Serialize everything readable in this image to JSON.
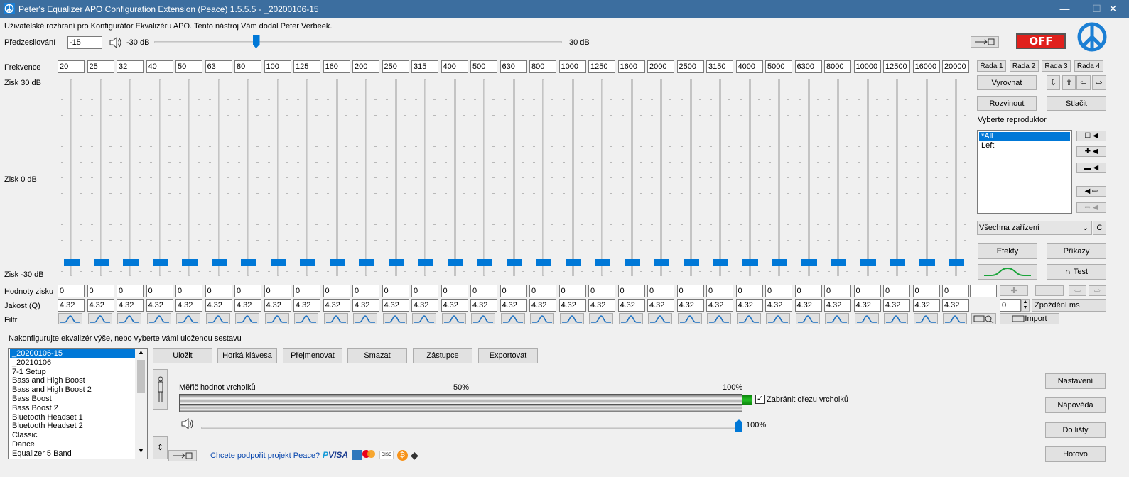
{
  "window": {
    "title": "Peter's Equalizer APO Configuration Extension (Peace) 1.5.5.5 - _20200106-15"
  },
  "header": {
    "info": "Uživatelské rozhraní pro Konfigurátor Ekvalizéru APO. Tento nástroj Vám dodal Peter Verbeek."
  },
  "preamp": {
    "label": "Předzesilování",
    "value": "-15",
    "min_label": "-30 dB",
    "max_label": "30 dB",
    "level": -15,
    "min": -30,
    "max": 30
  },
  "power": {
    "label": "OFF"
  },
  "eq": {
    "freq_label": "Frekvence",
    "gain_top": "Zisk 30 dB",
    "gain_mid": "Zisk 0 dB",
    "gain_bottom": "Zisk -30 dB",
    "gain_label": "Hodnoty zisku",
    "q_label": "Jakost (Q)",
    "filter_label": "Filtr",
    "bands": [
      {
        "freq": "20",
        "gain": "0",
        "q": "4.32"
      },
      {
        "freq": "25",
        "gain": "0",
        "q": "4.32"
      },
      {
        "freq": "32",
        "gain": "0",
        "q": "4.32"
      },
      {
        "freq": "40",
        "gain": "0",
        "q": "4.32"
      },
      {
        "freq": "50",
        "gain": "0",
        "q": "4.32"
      },
      {
        "freq": "63",
        "gain": "0",
        "q": "4.32"
      },
      {
        "freq": "80",
        "gain": "0",
        "q": "4.32"
      },
      {
        "freq": "100",
        "gain": "0",
        "q": "4.32"
      },
      {
        "freq": "125",
        "gain": "0",
        "q": "4.32"
      },
      {
        "freq": "160",
        "gain": "0",
        "q": "4.32"
      },
      {
        "freq": "200",
        "gain": "0",
        "q": "4.32"
      },
      {
        "freq": "250",
        "gain": "0",
        "q": "4.32"
      },
      {
        "freq": "315",
        "gain": "0",
        "q": "4.32"
      },
      {
        "freq": "400",
        "gain": "0",
        "q": "4.32"
      },
      {
        "freq": "500",
        "gain": "0",
        "q": "4.32"
      },
      {
        "freq": "630",
        "gain": "0",
        "q": "4.32"
      },
      {
        "freq": "800",
        "gain": "0",
        "q": "4.32"
      },
      {
        "freq": "1000",
        "gain": "0",
        "q": "4.32"
      },
      {
        "freq": "1250",
        "gain": "0",
        "q": "4.32"
      },
      {
        "freq": "1600",
        "gain": "0",
        "q": "4.32"
      },
      {
        "freq": "2000",
        "gain": "0",
        "q": "4.32"
      },
      {
        "freq": "2500",
        "gain": "0",
        "q": "4.32"
      },
      {
        "freq": "3150",
        "gain": "0",
        "q": "4.32"
      },
      {
        "freq": "4000",
        "gain": "0",
        "q": "4.32"
      },
      {
        "freq": "5000",
        "gain": "0",
        "q": "4.32"
      },
      {
        "freq": "6300",
        "gain": "0",
        "q": "4.32"
      },
      {
        "freq": "8000",
        "gain": "0",
        "q": "4.32"
      },
      {
        "freq": "10000",
        "gain": "0",
        "q": "4.32"
      },
      {
        "freq": "12500",
        "gain": "0",
        "q": "4.32"
      },
      {
        "freq": "16000",
        "gain": "0",
        "q": "4.32"
      },
      {
        "freq": "20000",
        "gain": "0",
        "q": "4.32"
      }
    ]
  },
  "right": {
    "rows": [
      "Řada 1",
      "Řada 2",
      "Řada 3",
      "Řada 4"
    ],
    "vyrovnat": "Vyrovnat",
    "rozvinout": "Rozvinout",
    "stlacit": "Stlačit",
    "speaker_label": "Vyberte reproduktor",
    "speakers": [
      "*All",
      "Left"
    ],
    "device": "Všechna zařízení",
    "device_c": "C",
    "efekty": "Efekty",
    "prikazy": "Příkazy",
    "test": "Test",
    "delay_value": "0",
    "delay_label": "Zpoždění ms",
    "import": "Import"
  },
  "preset": {
    "hint": "Nakonfigurujte ekvalizér výše, nebo vyberte vámi uloženou sestavu",
    "items": [
      "_20200106-15",
      "_20210106",
      "7-1 Setup",
      "Bass and High Boost",
      "Bass and High Boost 2",
      "Bass Boost",
      "Bass Boost 2",
      "Bluetooth Headset 1",
      "Bluetooth Headset 2",
      "Classic",
      "Dance",
      "Equalizer 5 Band"
    ],
    "buttons": [
      "Uložit",
      "Horká klávesa",
      "Přejmenovat",
      "Smazat",
      "Zástupce",
      "Exportovat"
    ]
  },
  "meter": {
    "label": "Měřič hodnot vrcholků",
    "mark_50": "50%",
    "mark_100": "100%",
    "clip_label": "Zabránit ořezu vrcholků",
    "volume_label": "100%",
    "volume": 100
  },
  "footer": {
    "support_link": "Chcete podpořit projekt Peace?",
    "paypal": "PayPal",
    "visa": "VISA"
  },
  "side_buttons": [
    "Nastavení",
    "Nápověda",
    "Do lišty",
    "Hotovo"
  ],
  "colors": {
    "titlebar": "#3c6e9f",
    "accent": "#0078d7",
    "off_red": "#e0201c",
    "meter_green": "#22c022",
    "link": "#0645ad"
  }
}
